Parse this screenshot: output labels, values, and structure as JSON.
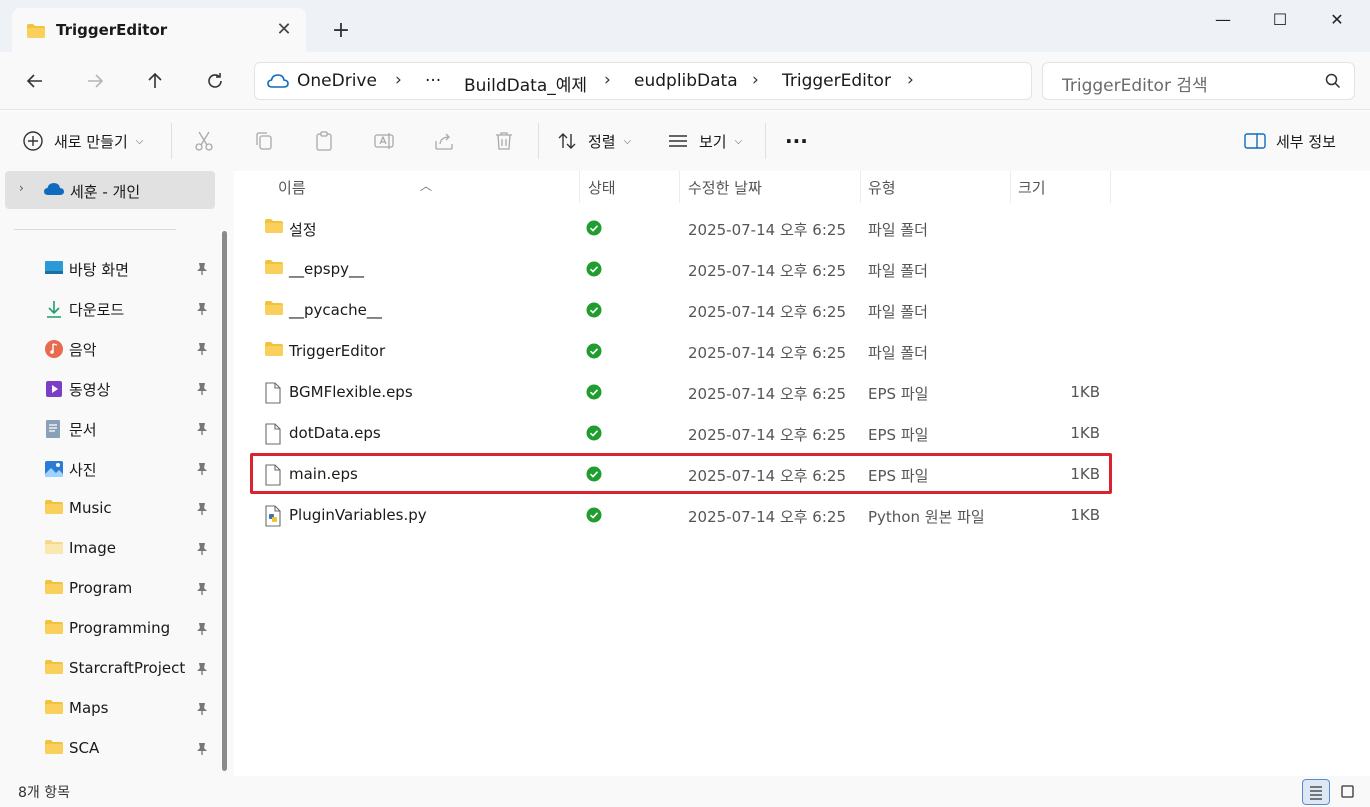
{
  "window": {
    "tab_title": "TriggerEditor",
    "new_tab": "+",
    "minimize": "—",
    "maximize": "☐",
    "close": "✕"
  },
  "nav": {
    "back_icon": "arrow-left",
    "forward_icon": "arrow-right",
    "up_icon": "arrow-up",
    "refresh_icon": "refresh",
    "breadcrumbs": [
      "OneDrive",
      "···",
      "BuildData_예제",
      "eudplibData",
      "TriggerEditor"
    ],
    "search_placeholder": "TriggerEditor 검색"
  },
  "toolbar": {
    "new_label": "새로 만들기",
    "sort_label": "정렬",
    "view_label": "보기",
    "more_label": "···",
    "details_label": "세부 정보"
  },
  "sidebar": {
    "onedrive_label": "세훈 - 개인",
    "items": [
      {
        "label": "바탕 화면",
        "icon": "desktop-icon"
      },
      {
        "label": "다운로드",
        "icon": "download-icon"
      },
      {
        "label": "음악",
        "icon": "music-icon"
      },
      {
        "label": "동영상",
        "icon": "video-icon"
      },
      {
        "label": "문서",
        "icon": "document-icon"
      },
      {
        "label": "사진",
        "icon": "pictures-icon"
      },
      {
        "label": "Music",
        "icon": "folder-icon"
      },
      {
        "label": "Image",
        "icon": "folder-icon"
      },
      {
        "label": "Program",
        "icon": "folder-icon"
      },
      {
        "label": "Programming",
        "icon": "folder-icon"
      },
      {
        "label": "StarcraftProject",
        "icon": "folder-icon"
      },
      {
        "label": "Maps",
        "icon": "folder-icon"
      },
      {
        "label": "SCA",
        "icon": "folder-icon"
      }
    ]
  },
  "columns": {
    "name": "이름",
    "status": "상태",
    "modified": "수정한 날짜",
    "type": "유형",
    "size": "크기"
  },
  "files": [
    {
      "name": "설정",
      "kind": "folder",
      "date": "2025-07-14 오후 6:25",
      "type": "파일 폴더",
      "size": ""
    },
    {
      "name": "__epspy__",
      "kind": "folder",
      "date": "2025-07-14 오후 6:25",
      "type": "파일 폴더",
      "size": ""
    },
    {
      "name": "__pycache__",
      "kind": "folder",
      "date": "2025-07-14 오후 6:25",
      "type": "파일 폴더",
      "size": ""
    },
    {
      "name": "TriggerEditor",
      "kind": "folder",
      "date": "2025-07-14 오후 6:25",
      "type": "파일 폴더",
      "size": ""
    },
    {
      "name": "BGMFlexible.eps",
      "kind": "file",
      "date": "2025-07-14 오후 6:25",
      "type": "EPS 파일",
      "size": "1KB"
    },
    {
      "name": "dotData.eps",
      "kind": "file",
      "date": "2025-07-14 오후 6:25",
      "type": "EPS 파일",
      "size": "1KB"
    },
    {
      "name": "main.eps",
      "kind": "file",
      "date": "2025-07-14 오후 6:25",
      "type": "EPS 파일",
      "size": "1KB"
    },
    {
      "name": "PluginVariables.py",
      "kind": "python",
      "date": "2025-07-14 오후 6:25",
      "type": "Python 원본 파일",
      "size": "1KB"
    }
  ],
  "status": {
    "item_count": "8개 항목"
  },
  "colors": {
    "highlight": "#d9232e",
    "folder": "#f3c23d",
    "sync_ok": "#1f9d2e",
    "onedrive": "#0f6cbd"
  }
}
